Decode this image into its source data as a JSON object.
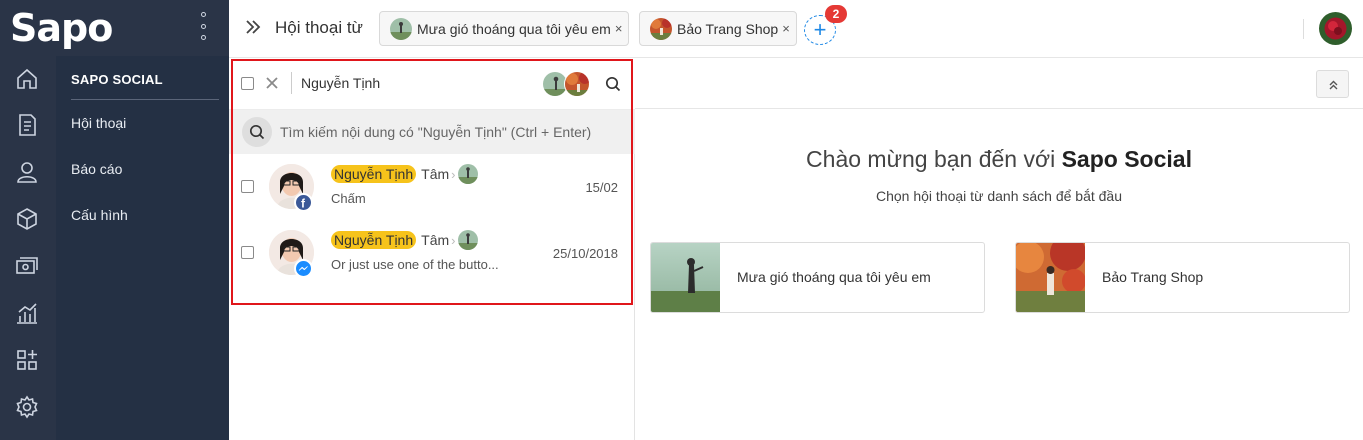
{
  "app": {
    "logo_text": "Sapo",
    "module_title": "SAPO SOCIAL",
    "menu": [
      {
        "label": "Hội thoại"
      },
      {
        "label": "Báo cáo"
      },
      {
        "label": "Cấu hình"
      }
    ],
    "rail_icons": [
      "home-icon",
      "orders-icon",
      "customer-icon",
      "product-icon",
      "cashbook-icon",
      "report-icon",
      "apps-icon",
      "settings-icon"
    ]
  },
  "topbar": {
    "title": "Hội thoại từ",
    "tabs": [
      {
        "label": "Mưa gió thoáng qua tôi yêu em",
        "close": "×"
      },
      {
        "label": "Bảo Trang Shop",
        "close": "×"
      }
    ],
    "add_tab_symbol": "+",
    "add_tab_badge": "2"
  },
  "conversation_list": {
    "search_value": "Nguyễn Tịnh",
    "content_search_hint": "Tìm kiếm nội dung có \"Nguyễn Tịnh\" (Ctrl + Enter)",
    "items": [
      {
        "name": "Nguyễn Tịnh",
        "staff": "Tâm",
        "arrow": "›",
        "preview": "Chấm",
        "date": "15/02",
        "channel": "facebook"
      },
      {
        "name": "Nguyễn Tịnh",
        "staff": "Tâm",
        "arrow": "›",
        "preview": "Or just use one of the butto...",
        "date": "25/10/2018",
        "channel": "messenger"
      }
    ]
  },
  "main": {
    "welcome_prefix": "Chào mừng bạn đến với",
    "welcome_brand": "Sapo Social",
    "welcome_sub": "Chọn hội thoại từ danh sách để bắt đầu",
    "pages": [
      {
        "label": "Mưa gió thoáng qua tôi yêu em"
      },
      {
        "label": "Bảo Trang Shop"
      }
    ]
  },
  "colors": {
    "sidebar": "#2a3447",
    "submenu": "#243044",
    "accent": "#1e88e5",
    "highlight": "#f6c31b",
    "badge": "#e53935",
    "annotation_box": "#e0161b"
  }
}
